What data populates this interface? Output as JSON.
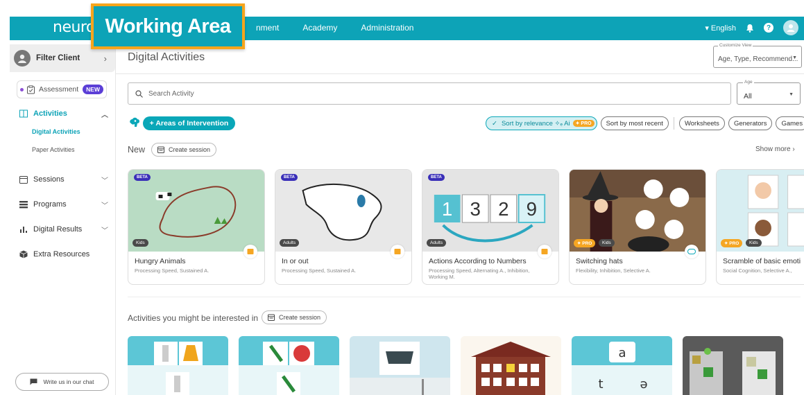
{
  "app": {
    "logo": "neuron"
  },
  "overlay": {
    "label": "Working Area"
  },
  "nav": {
    "items": [
      "nment",
      "Academy",
      "Administration"
    ]
  },
  "topright": {
    "language": "English"
  },
  "sidebar": {
    "filter_client": "Filter Client",
    "assessment": "Assessment",
    "new_badge": "NEW",
    "activities": "Activities",
    "digital_activities": "Digital Activities",
    "paper_activities": "Paper Activities",
    "sessions": "Sessions",
    "programs": "Programs",
    "digital_results": "Digital Results",
    "extra_resources": "Extra Resources",
    "chat": "Write us in our chat"
  },
  "main": {
    "title": "Digital Activities",
    "customize_view": {
      "label": "Customize View",
      "value": "Age, Type, Recommend..."
    },
    "search_placeholder": "Search Activity",
    "age": {
      "label": "Age",
      "value": "All"
    },
    "areas_button": "+ Areas of Intervention",
    "sort_relevance": "Sort by relevance ✧ₑ Ai",
    "pro": "PRO",
    "sort_recent": "Sort by most recent",
    "filters": [
      "Worksheets",
      "Generators",
      "Games"
    ],
    "new_label": "New",
    "create_session": "Create session",
    "show_more": "Show more",
    "interested_label": "Activities you might be interested in"
  },
  "new_cards": [
    {
      "title": "Hungry Animals",
      "sub": "Processing Speed, Sustained A.",
      "badge": "BETA",
      "age": "Kids",
      "pro": ""
    },
    {
      "title": "In or out",
      "sub": "Processing Speed, Sustained A.",
      "badge": "BETA",
      "age": "Adults",
      "pro": ""
    },
    {
      "title": "Actions According to Numbers",
      "sub": "Processing Speed, Alternating A., Inhibition, Working M.",
      "badge": "BETA",
      "age": "Adults",
      "pro": ""
    },
    {
      "title": "Switching hats",
      "sub": "Flexibility, Inhibition, Selective A.",
      "badge": "",
      "age": "Kids",
      "pro": "PRO"
    },
    {
      "title": "Scramble of basic emoti",
      "sub": "Social Cognition, Selective A.,",
      "badge": "",
      "age": "Kids",
      "pro": "PRO"
    }
  ],
  "numbers_card": {
    "digits": [
      "1",
      "3",
      "2",
      "9"
    ]
  },
  "letter_card": {
    "top": "a",
    "left": "t",
    "right": "ə"
  },
  "colors": {
    "accent": "#0da3b7",
    "highlight": "#f7a51c",
    "badge": "#3a2fb8",
    "pro": "#f5a623"
  }
}
